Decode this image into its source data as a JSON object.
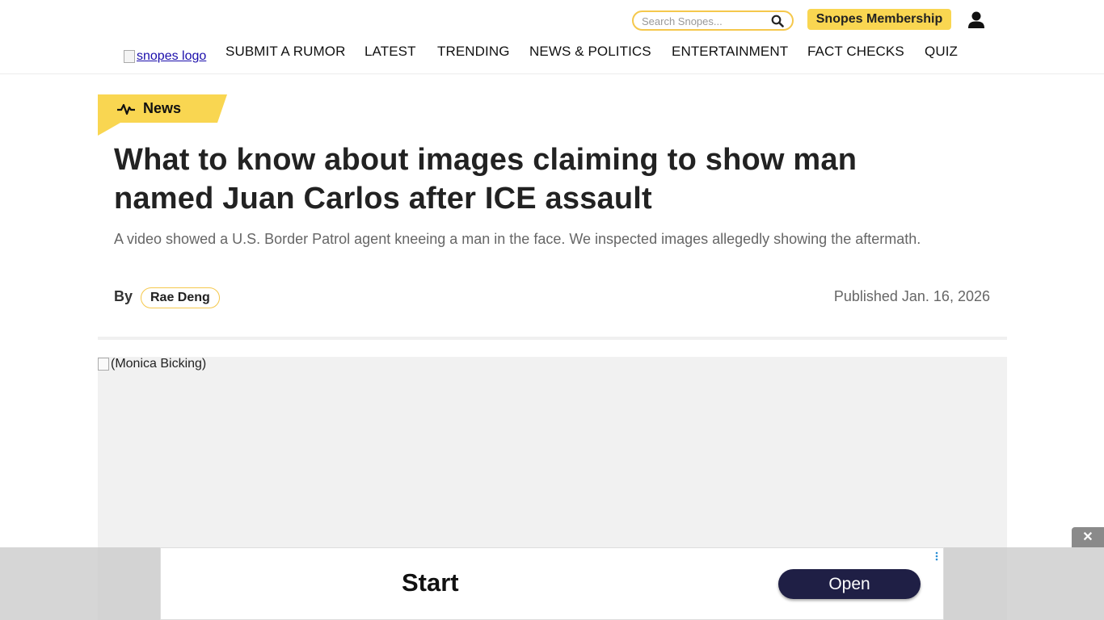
{
  "header": {
    "search_placeholder": "Search Snopes...",
    "membership_label": "Snopes Membership",
    "logo_alt": "snopes logo",
    "nav": [
      "SUBMIT A RUMOR",
      "LATEST",
      "TRENDING",
      "NEWS & POLITICS",
      "ENTERTAINMENT",
      "FACT CHECKS",
      "QUIZ"
    ]
  },
  "article": {
    "category": "News",
    "title": "What to know about images claiming to show man named Juan Carlos after ICE assault",
    "subtitle": "A video showed a U.S. Border Patrol agent kneeing a man in the face. We inspected images allegedly showing the aftermath.",
    "by_label": "By",
    "author": "Rae Deng",
    "published": "Published Jan. 16, 2026",
    "image_alt": "(Monica Bicking)"
  },
  "ad": {
    "headline": "Start",
    "button_label": "Open",
    "close_label": "✕"
  },
  "colors": {
    "accent_yellow": "#f9d651",
    "ad_button": "#1f1f45"
  }
}
